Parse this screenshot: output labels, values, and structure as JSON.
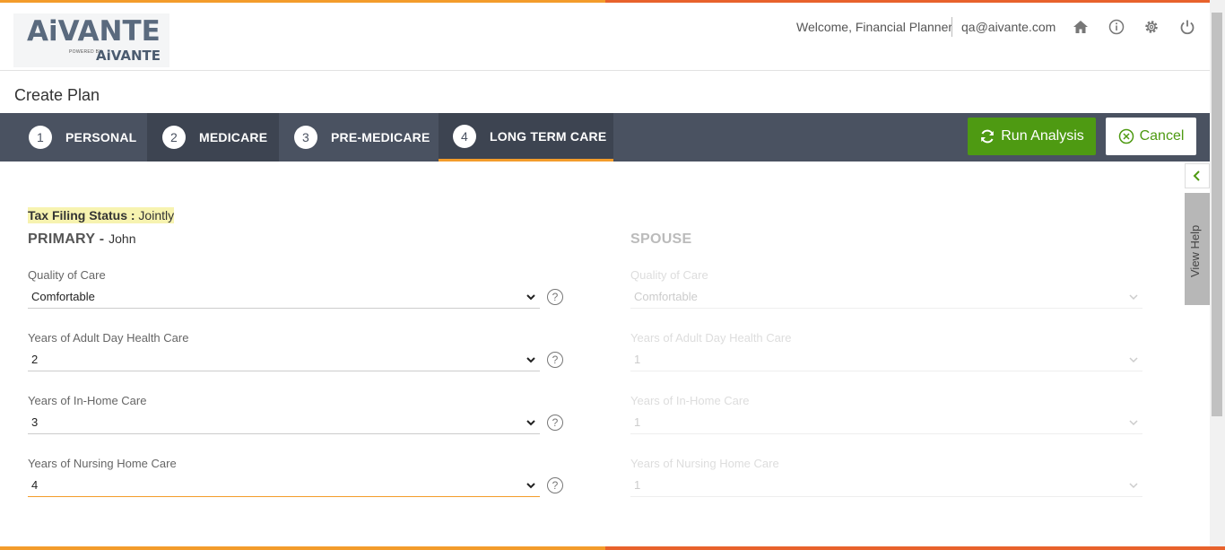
{
  "header": {
    "logo_text": "AiVANTE",
    "logo_powered": "POWERED BY",
    "logo_sub": "AiVANTE",
    "welcome": "Welcome, Financial Planner",
    "email": "qa@aivante.com"
  },
  "page_title": "Create Plan",
  "steps": [
    {
      "num": "1",
      "label": "PERSONAL"
    },
    {
      "num": "2",
      "label": "MEDICARE"
    },
    {
      "num": "3",
      "label": "PRE-MEDICARE"
    },
    {
      "num": "4",
      "label": "LONG TERM CARE"
    }
  ],
  "actions": {
    "run": "Run Analysis",
    "cancel": "Cancel"
  },
  "side": {
    "view_help": "View Help"
  },
  "tax": {
    "label": "Tax Filing Status :",
    "value": "Jointly"
  },
  "primary": {
    "heading": "PRIMARY -",
    "name": "John",
    "fields": [
      {
        "label": "Quality of Care",
        "value": "Comfortable"
      },
      {
        "label": "Years of Adult Day Health Care",
        "value": "2"
      },
      {
        "label": "Years of In-Home Care",
        "value": "3"
      },
      {
        "label": "Years of Nursing Home Care",
        "value": "4"
      }
    ]
  },
  "spouse": {
    "heading": "SPOUSE",
    "fields": [
      {
        "label": "Quality of Care",
        "value": "Comfortable"
      },
      {
        "label": "Years of Adult Day Health Care",
        "value": "1"
      },
      {
        "label": "Years of In-Home Care",
        "value": "1"
      },
      {
        "label": "Years of Nursing Home Care",
        "value": "1"
      }
    ]
  },
  "help_symbol": "?",
  "colors": {
    "accent_orange": "#f39c2b",
    "brand_green": "#4e9a12",
    "stepbar": "#4a5261"
  }
}
